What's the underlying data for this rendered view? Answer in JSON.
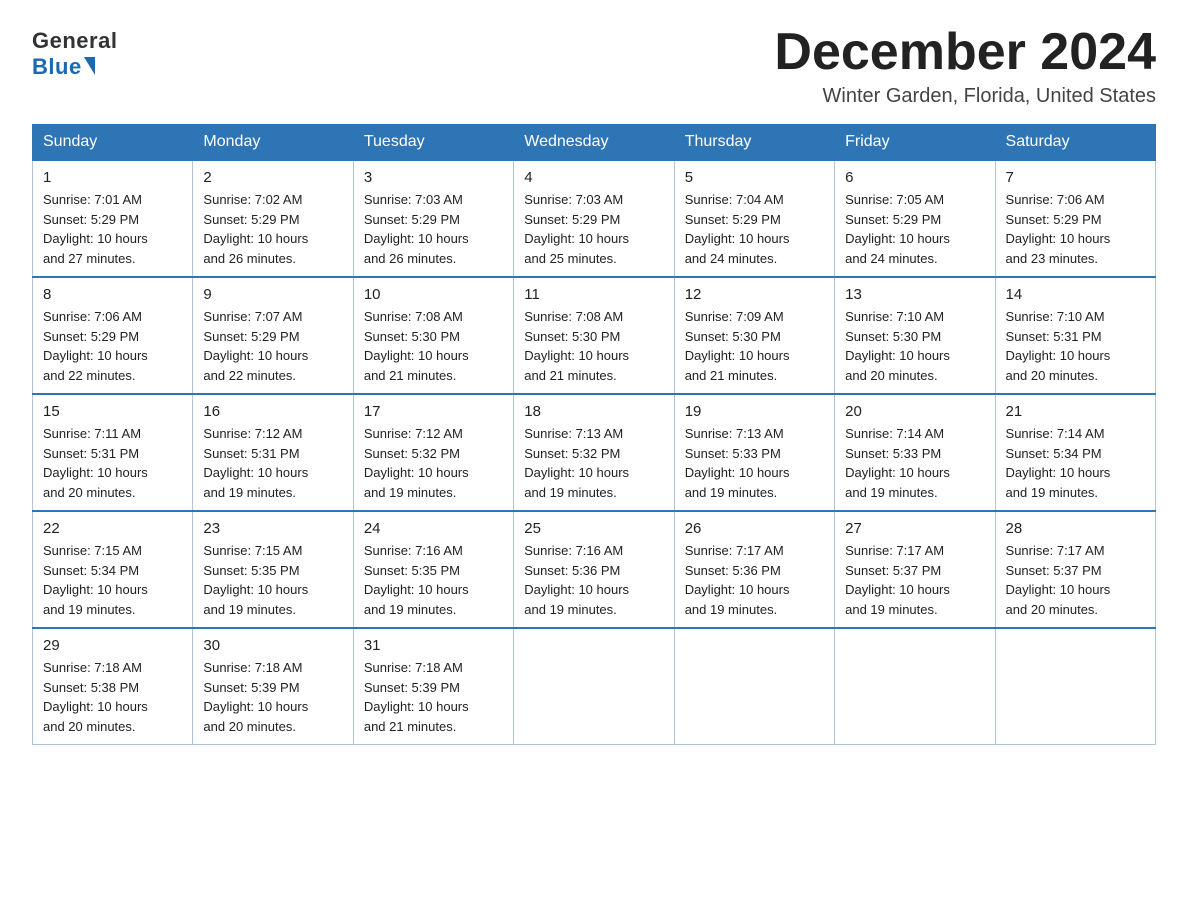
{
  "logo": {
    "general": "General",
    "blue": "Blue"
  },
  "header": {
    "month": "December 2024",
    "location": "Winter Garden, Florida, United States"
  },
  "weekdays": [
    "Sunday",
    "Monday",
    "Tuesday",
    "Wednesday",
    "Thursday",
    "Friday",
    "Saturday"
  ],
  "weeks": [
    [
      {
        "day": "1",
        "sunrise": "7:01 AM",
        "sunset": "5:29 PM",
        "daylight": "10 hours and 27 minutes."
      },
      {
        "day": "2",
        "sunrise": "7:02 AM",
        "sunset": "5:29 PM",
        "daylight": "10 hours and 26 minutes."
      },
      {
        "day": "3",
        "sunrise": "7:03 AM",
        "sunset": "5:29 PM",
        "daylight": "10 hours and 26 minutes."
      },
      {
        "day": "4",
        "sunrise": "7:03 AM",
        "sunset": "5:29 PM",
        "daylight": "10 hours and 25 minutes."
      },
      {
        "day": "5",
        "sunrise": "7:04 AM",
        "sunset": "5:29 PM",
        "daylight": "10 hours and 24 minutes."
      },
      {
        "day": "6",
        "sunrise": "7:05 AM",
        "sunset": "5:29 PM",
        "daylight": "10 hours and 24 minutes."
      },
      {
        "day": "7",
        "sunrise": "7:06 AM",
        "sunset": "5:29 PM",
        "daylight": "10 hours and 23 minutes."
      }
    ],
    [
      {
        "day": "8",
        "sunrise": "7:06 AM",
        "sunset": "5:29 PM",
        "daylight": "10 hours and 22 minutes."
      },
      {
        "day": "9",
        "sunrise": "7:07 AM",
        "sunset": "5:29 PM",
        "daylight": "10 hours and 22 minutes."
      },
      {
        "day": "10",
        "sunrise": "7:08 AM",
        "sunset": "5:30 PM",
        "daylight": "10 hours and 21 minutes."
      },
      {
        "day": "11",
        "sunrise": "7:08 AM",
        "sunset": "5:30 PM",
        "daylight": "10 hours and 21 minutes."
      },
      {
        "day": "12",
        "sunrise": "7:09 AM",
        "sunset": "5:30 PM",
        "daylight": "10 hours and 21 minutes."
      },
      {
        "day": "13",
        "sunrise": "7:10 AM",
        "sunset": "5:30 PM",
        "daylight": "10 hours and 20 minutes."
      },
      {
        "day": "14",
        "sunrise": "7:10 AM",
        "sunset": "5:31 PM",
        "daylight": "10 hours and 20 minutes."
      }
    ],
    [
      {
        "day": "15",
        "sunrise": "7:11 AM",
        "sunset": "5:31 PM",
        "daylight": "10 hours and 20 minutes."
      },
      {
        "day": "16",
        "sunrise": "7:12 AM",
        "sunset": "5:31 PM",
        "daylight": "10 hours and 19 minutes."
      },
      {
        "day": "17",
        "sunrise": "7:12 AM",
        "sunset": "5:32 PM",
        "daylight": "10 hours and 19 minutes."
      },
      {
        "day": "18",
        "sunrise": "7:13 AM",
        "sunset": "5:32 PM",
        "daylight": "10 hours and 19 minutes."
      },
      {
        "day": "19",
        "sunrise": "7:13 AM",
        "sunset": "5:33 PM",
        "daylight": "10 hours and 19 minutes."
      },
      {
        "day": "20",
        "sunrise": "7:14 AM",
        "sunset": "5:33 PM",
        "daylight": "10 hours and 19 minutes."
      },
      {
        "day": "21",
        "sunrise": "7:14 AM",
        "sunset": "5:34 PM",
        "daylight": "10 hours and 19 minutes."
      }
    ],
    [
      {
        "day": "22",
        "sunrise": "7:15 AM",
        "sunset": "5:34 PM",
        "daylight": "10 hours and 19 minutes."
      },
      {
        "day": "23",
        "sunrise": "7:15 AM",
        "sunset": "5:35 PM",
        "daylight": "10 hours and 19 minutes."
      },
      {
        "day": "24",
        "sunrise": "7:16 AM",
        "sunset": "5:35 PM",
        "daylight": "10 hours and 19 minutes."
      },
      {
        "day": "25",
        "sunrise": "7:16 AM",
        "sunset": "5:36 PM",
        "daylight": "10 hours and 19 minutes."
      },
      {
        "day": "26",
        "sunrise": "7:17 AM",
        "sunset": "5:36 PM",
        "daylight": "10 hours and 19 minutes."
      },
      {
        "day": "27",
        "sunrise": "7:17 AM",
        "sunset": "5:37 PM",
        "daylight": "10 hours and 19 minutes."
      },
      {
        "day": "28",
        "sunrise": "7:17 AM",
        "sunset": "5:37 PM",
        "daylight": "10 hours and 20 minutes."
      }
    ],
    [
      {
        "day": "29",
        "sunrise": "7:18 AM",
        "sunset": "5:38 PM",
        "daylight": "10 hours and 20 minutes."
      },
      {
        "day": "30",
        "sunrise": "7:18 AM",
        "sunset": "5:39 PM",
        "daylight": "10 hours and 20 minutes."
      },
      {
        "day": "31",
        "sunrise": "7:18 AM",
        "sunset": "5:39 PM",
        "daylight": "10 hours and 21 minutes."
      },
      null,
      null,
      null,
      null
    ]
  ],
  "labels": {
    "sunrise": "Sunrise:",
    "sunset": "Sunset:",
    "daylight": "Daylight:"
  }
}
